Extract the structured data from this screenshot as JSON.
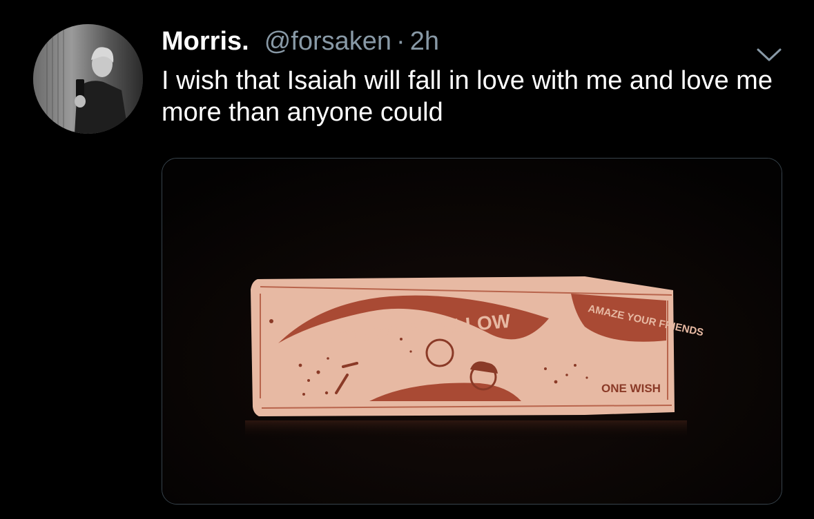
{
  "tweet": {
    "author_name": "Morris.",
    "handle": "@forsaken",
    "separator": "·",
    "time": "2h",
    "text": "I wish that Isaiah will fall in love with me and love me more than anyone could"
  },
  "media": {
    "brand_text": "ONE WISH WILLOW",
    "tagline": "AMAZE YOUR FRIENDS",
    "footer_text": "ONE WISH"
  },
  "icons": {
    "menu": "chevron-down-icon",
    "avatar": "profile-photo"
  },
  "colors": {
    "background": "#000000",
    "text": "#ffffff",
    "muted": "#8899a6",
    "border": "#38444d",
    "package_cream": "#eebfa8",
    "package_red": "#a94a34"
  }
}
